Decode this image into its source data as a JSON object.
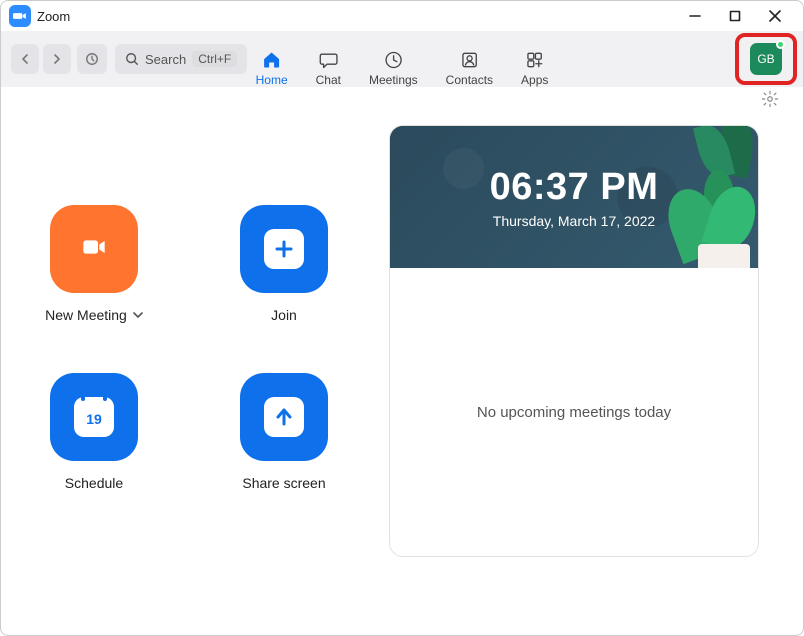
{
  "titlebar": {
    "app_name": "Zoom"
  },
  "toolbar": {
    "search_placeholder": "Search",
    "search_shortcut": "Ctrl+F",
    "tabs": {
      "home": "Home",
      "chat": "Chat",
      "meetings": "Meetings",
      "contacts": "Contacts",
      "apps": "Apps"
    },
    "avatar_initials": "GB"
  },
  "actions": {
    "new_meeting": "New Meeting",
    "join": "Join",
    "schedule": "Schedule",
    "share_screen": "Share screen",
    "calendar_day": "19"
  },
  "card": {
    "time": "06:37 PM",
    "date": "Thursday, March 17, 2022",
    "empty_state": "No upcoming meetings today"
  }
}
